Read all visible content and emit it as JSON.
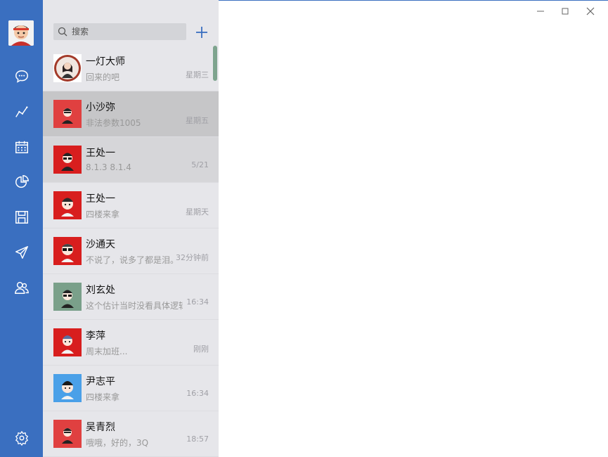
{
  "colors": {
    "sidebar": "#3a6fc0",
    "list_bg": "#e6e6ea",
    "selected": "#c6c6c8",
    "hover": "#d6d6d9",
    "scrollbar": "#7ea48e"
  },
  "search": {
    "placeholder": "搜索"
  },
  "nav": [
    "chat-icon",
    "trend-icon",
    "calendar-icon",
    "pie-chart-icon",
    "save-icon",
    "send-icon",
    "contacts-icon",
    "settings-icon"
  ],
  "contacts": [
    {
      "name": "一灯大师",
      "preview": "回来的吧",
      "time": "星期三",
      "avatar_color": "#ffffff"
    },
    {
      "name": "小沙弥",
      "preview": "非法参数1005",
      "time": "星期五",
      "avatar_color": "#e04040"
    },
    {
      "name": "王处一",
      "preview": "8.1.3   8.1.4",
      "time": "5/21",
      "avatar_color": "#d81e1e"
    },
    {
      "name": "王处一",
      "preview": "四楼来拿",
      "time": "星期天",
      "avatar_color": "#d81e1e"
    },
    {
      "name": "沙通天",
      "preview": "不说了，说多了都是泪。",
      "time": "32分钟前",
      "avatar_color": "#d81e1e"
    },
    {
      "name": "刘玄处",
      "preview": "这个估计当时没看具体逻辑",
      "time": "16:34",
      "avatar_color": "#7aa08a"
    },
    {
      "name": "李萍",
      "preview": "周末加班...",
      "time": "刚刚",
      "avatar_color": "#d81e1e"
    },
    {
      "name": "尹志平",
      "preview": "四楼来拿",
      "time": "16:34",
      "avatar_color": "#4aa0e8"
    },
    {
      "name": "吴青烈",
      "preview": "哦哦，好的，3Q",
      "time": "18:57",
      "avatar_color": "#e04040"
    }
  ]
}
